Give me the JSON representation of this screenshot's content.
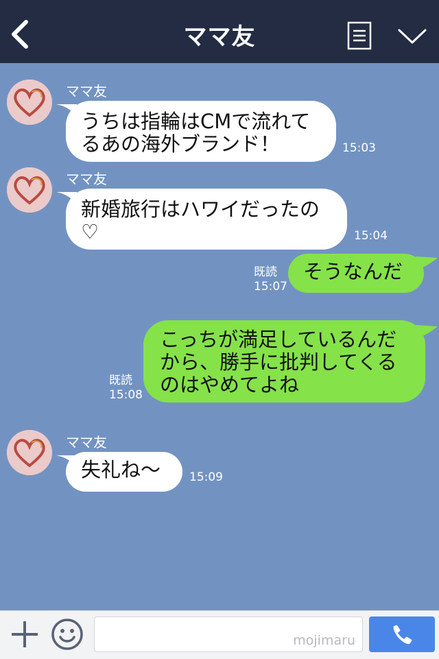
{
  "header": {
    "title": "ママ友",
    "back_icon": "chevron-left-icon",
    "note_icon": "notes-icon",
    "menu_icon": "chevron-down-icon",
    "background_color": "#232c43"
  },
  "chat": {
    "background_color": "#7293c2",
    "messages": [
      {
        "direction": "incoming",
        "sender": "ママ友",
        "lines": [
          "うちは指輪はCMで流れて",
          "るあの海外ブランド！"
        ],
        "time": "15:03"
      },
      {
        "direction": "incoming",
        "sender": "ママ友",
        "lines": [
          "新婚旅行はハワイだったの",
          "♡"
        ],
        "time": "15:04"
      },
      {
        "direction": "outgoing",
        "read": "既読",
        "lines": [
          "そうなんだ"
        ],
        "time": "15:07"
      },
      {
        "direction": "outgoing",
        "read": "既読",
        "lines": [
          "こっちが満足しているんだ",
          "から、勝手に批判してくる",
          "のはやめてよね"
        ],
        "time": "15:08"
      },
      {
        "direction": "incoming",
        "sender": "ママ友",
        "lines": [
          "失礼ね〜"
        ],
        "time": "15:09"
      }
    ]
  },
  "bottom_bar": {
    "plus_icon": "plus-icon",
    "emoji_icon": "smiley-icon",
    "input_value": "",
    "watermark": "mojimaru",
    "call_icon": "phone-icon",
    "accent_color": "#4a86e8"
  },
  "colors": {
    "incoming_bubble": "#ffffff",
    "outgoing_bubble": "#85e249"
  }
}
